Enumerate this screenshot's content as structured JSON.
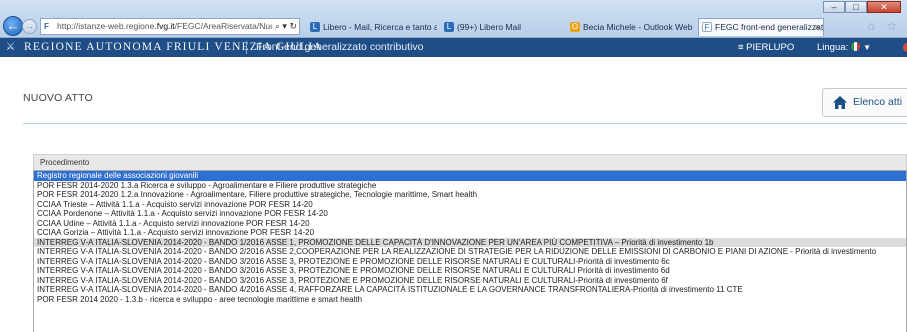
{
  "browser": {
    "url_prefix": "http://istanze-web.regione.",
    "url_host": "fvg.it",
    "url_suffix": "/FEGC/AreaRiservata/Nuo",
    "url_tools": "⌕ ▾ ↻",
    "tabs": [
      {
        "label": "Libero - Mail, Ricerca e tanto al...",
        "active": false
      },
      {
        "label": "(99+) Libero Mail",
        "active": false
      },
      {
        "label": "Becia Michele - Outlook Web ...",
        "active": false
      },
      {
        "label": "FEGC front-end generalizzat...",
        "active": true
      }
    ],
    "tab_close": "×",
    "tools": "⌂ ☆",
    "window_buttons": {
      "minimize": "–",
      "maximize": "□",
      "close": "✕"
    }
  },
  "header": {
    "region": "REGIONE AUTONOMA FRIULI VENEZIA GIULIA",
    "subtitle": "Front-end generalizzato contributivo",
    "user_menu": "≡ PIERLUPO",
    "language_label": "Lingua:"
  },
  "page": {
    "title": "NUOVO ATTO",
    "elenco_button": "Elenco atti"
  },
  "procedimento": {
    "label": "Procedimento",
    "options": [
      "Registro regionale delle associazioni giovanili",
      "POR FESR 2014-2020 1.3.a Ricerca e sviluppo - Agroalimentare e Filiere produttive strategiche",
      "POR FESR 2014-2020 1.2.a Innovazione - Agroalimentare, Filiere produttive strategiche, Tecnologie marittime, Smart health",
      "CCIAA Trieste – Attività 1.1.a - Acquisto servizi innovazione POR FESR 14-20",
      "CCIAA Pordenone – Attività 1.1.a - Acquisto servizi innovazione POR FESR 14-20",
      "CCIAA Udine – Attività 1.1.a - Acquisto servizi innovazione POR FESR 14-20",
      "CCIAA Gorizia – Attività 1.1.a - Acquisto servizi innovazione POR FESR 14-20",
      "INTERREG V-A ITALIA-SLOVENIA 2014-2020 - BANDO 1/2016 ASSE 1, PROMOZIONE DELLE CAPACITÀ D'INNOVAZIONE PER UN'AREA PIÙ COMPETITIVA – Priorità di investimento 1b",
      "INTERREG V-A ITALIA-SLOVENIA 2014-2020 - BANDO 2/2016 ASSE 2,COOPERAZIONE PER LA REALIZZAZIONE DI STRATEGIE PER LA RIDUZIONE DELLE EMISSIONI DI CARBONIO E PIANI DI AZIONE - Priorità di investimento",
      "INTERREG V-A ITALIA-SLOVENIA 2014-2020 - BANDO 3/2016 ASSE 3, PROTEZIONE E PROMOZIONE DELLE RISORSE NATURALI E CULTURALI-Priorità di investimento 6c",
      "INTERREG V-A ITALIA-SLOVENIA 2014-2020 - BANDO 3/2016 ASSE 3, PROTEZIONE E PROMOZIONE DELLE RISORSE NATURALI E CULTURALI Priorità di investimento 6d",
      "INTERREG V-A ITALIA-SLOVENIA 2014-2020 - BANDO 3/2016 ASSE 3, PROTEZIONE E PROMOZIONE DELLE RISORSE NATURALI E CULTURALI-Priorità di investimento 6f",
      "INTERREG V-A ITALIA-SLOVENIA 2014-2020 - BANDO 4/2016 ASSE 4, RAFFORZARE LA CAPACITÀ ISTITUZIONALE E LA GOVERNANCE TRANSFRONTALIERA-Priorità di investimento 11 CTE",
      "POR FESR 2014 2020 - 1.3.b - ricerca e sviluppo - aree tecnologie marittime e smart health"
    ],
    "selected_index": 0,
    "hover_index": 7
  },
  "colors": {
    "header_bg": "#1f4e87",
    "selected_option": "#2f6fcf",
    "hover_option": "#dcdcdc"
  }
}
